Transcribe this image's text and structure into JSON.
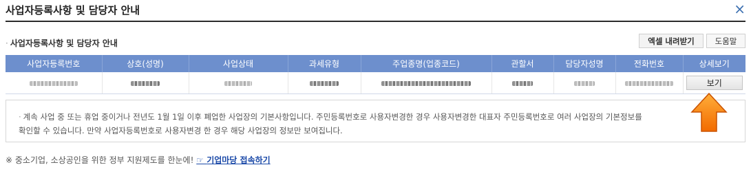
{
  "dialog": {
    "title": "사업자등록사항 및 담당자 안내",
    "close_icon": "×"
  },
  "section": {
    "heading_marker": "·",
    "heading": "사업자등록사항 및 담당자 안내",
    "excel_label": "엑셀 내려받기",
    "help_label": "도움말"
  },
  "table": {
    "headers": [
      "사업자등록번호",
      "상호(성명)",
      "사업상태",
      "과세유형",
      "주업종명(업종코드)",
      "관할서",
      "담당자성명",
      "전화번호",
      "상세보기"
    ],
    "view_label": "보기"
  },
  "notice": {
    "bullet": "·",
    "text": "계속 사업 중 또는 휴업 중이거나 전년도 1월 1일 이후 폐업한 사업장의 기본사항입니다. 주민등록번호로 사용자변경한 경우 사용자변경한 대표자 주민등록번호로 여러 사업장의 기본정보를\n확인할 수 있습니다. 만약 사업자등록번호로 사용자변경 한 경우 해당 사업장의 정보만 보여집니다."
  },
  "footer": {
    "text": "※ 중소기업, 소상공인을 위한 정부 지원제도를 한눈에! ",
    "link_icon": "☞",
    "link": "기업마당 접속하기"
  },
  "colors": {
    "header_bg": "#6d8fcd",
    "arrow": "#f77a00",
    "link": "#1a49a8"
  }
}
